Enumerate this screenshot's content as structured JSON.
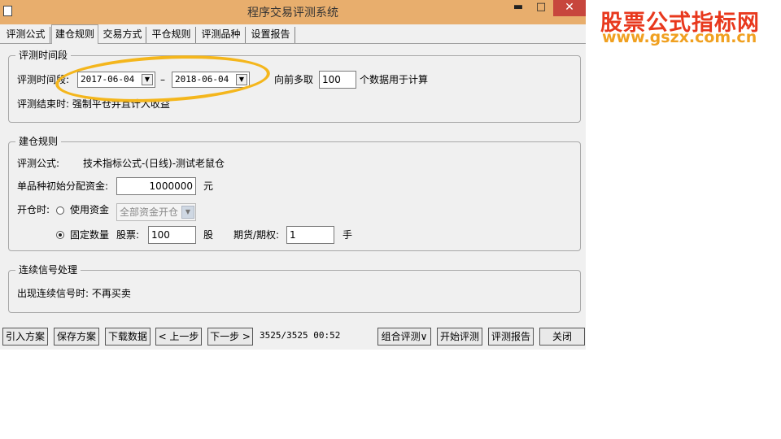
{
  "window": {
    "title": "程序交易评测系统",
    "min_glyph": "▬",
    "max_glyph": "□",
    "close_glyph": "✕"
  },
  "tabs": [
    {
      "label": "评测公式"
    },
    {
      "label": "建仓规则"
    },
    {
      "label": "交易方式"
    },
    {
      "label": "平仓规则"
    },
    {
      "label": "评测品种"
    },
    {
      "label": "设置报告"
    }
  ],
  "eval_period": {
    "legend": "评测时间段",
    "label": "评测时间段:",
    "start_date": "2017-06-04",
    "separator": "–",
    "end_date": "2018-06-04",
    "lookback_prefix": "向前多取",
    "lookback_value": "100",
    "lookback_suffix": "个数据用于计算",
    "end_rule": "评测结束时: 强制平仓并且计入收益"
  },
  "build_rules": {
    "legend": "建仓规则",
    "formula_label": "评测公式:",
    "formula_value": "技术指标公式-(日线)-测试老鼠仓",
    "capital_label": "单品种初始分配资金:",
    "capital_value": "1000000",
    "capital_unit": "元",
    "open_label": "开仓时:",
    "use_capital_label": "使用资金",
    "capital_mode": "全部资金开仓",
    "fixed_qty_label": "固定数量",
    "stock_label": "股票:",
    "stock_qty": "100",
    "stock_unit": "股",
    "futures_label": "期货/期权:",
    "futures_qty": "1",
    "futures_unit": "手"
  },
  "signals": {
    "legend": "连续信号处理",
    "rule": "出现连续信号时: 不再买卖"
  },
  "buttons": {
    "import": "引入方案",
    "save": "保存方案",
    "download": "下载数据",
    "prev": "< 上一步",
    "next": "下一步 >",
    "status": "3525/3525 00:52",
    "combo_eval": "组合评测∨",
    "start_eval": "开始评测",
    "report": "评测报告",
    "close": "关闭"
  },
  "watermark": {
    "line1": "股票公式指标网",
    "line2": "www.gszx.com.cn"
  },
  "colors": {
    "titlebar": "#e8ae6d",
    "close_button": "#c7463d",
    "highlight": "#f4b61c",
    "brand_red": "#e8381d",
    "brand_orange": "#f0a020"
  },
  "icons": {
    "dropdown": "▼"
  }
}
